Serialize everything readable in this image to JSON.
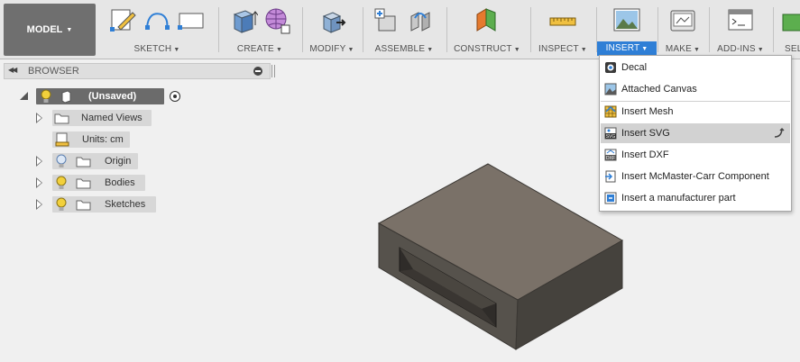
{
  "toolbar": {
    "model_label": "MODEL",
    "groups": [
      {
        "label": "SKETCH",
        "icons": [
          "sketch-create-icon",
          "arc-icon",
          "rectangle-icon"
        ]
      },
      {
        "label": "CREATE",
        "icons": [
          "box-extrude-icon",
          "form-grid-icon"
        ]
      },
      {
        "label": "MODIFY",
        "icons": [
          "press-pull-icon"
        ]
      },
      {
        "label": "ASSEMBLE",
        "icons": [
          "new-component-icon",
          "joint-icon"
        ]
      },
      {
        "label": "CONSTRUCT",
        "icons": [
          "plane-icon"
        ]
      },
      {
        "label": "INSPECT",
        "icons": [
          "measure-icon"
        ]
      },
      {
        "label": "INSERT",
        "icons": [
          "insert-image-icon"
        ]
      },
      {
        "label": "MAKE",
        "icons": [
          "print-3d-icon"
        ]
      },
      {
        "label": "ADD-INS",
        "icons": [
          "scripts-icon"
        ]
      },
      {
        "label": "SEL",
        "icons": [
          "select-icon"
        ]
      }
    ]
  },
  "browser": {
    "title": "BROWSER",
    "root": "(Unsaved)",
    "items": [
      {
        "label": "Named Views"
      },
      {
        "label": "Units: cm"
      },
      {
        "label": "Origin"
      },
      {
        "label": "Bodies"
      },
      {
        "label": "Sketches"
      }
    ]
  },
  "insert_menu": {
    "items": [
      {
        "label": "Decal",
        "icon": "decal-icon"
      },
      {
        "label": "Attached Canvas",
        "icon": "canvas-icon"
      },
      {
        "label": "Insert Mesh",
        "icon": "mesh-icon"
      },
      {
        "label": "Insert SVG",
        "icon": "svg-icon",
        "highlighted": true
      },
      {
        "label": "Insert DXF",
        "icon": "dxf-icon"
      },
      {
        "label": "Insert McMaster-Carr Component",
        "icon": "mcmaster-icon"
      },
      {
        "label": "Insert a manufacturer part",
        "icon": "manufacturer-part-icon"
      }
    ]
  },
  "colors": {
    "accent": "#2f7fd6",
    "model_bg": "#6f6f6f",
    "body_top": "#7a7168",
    "body_left": "#56524c",
    "body_right": "#45423d"
  }
}
